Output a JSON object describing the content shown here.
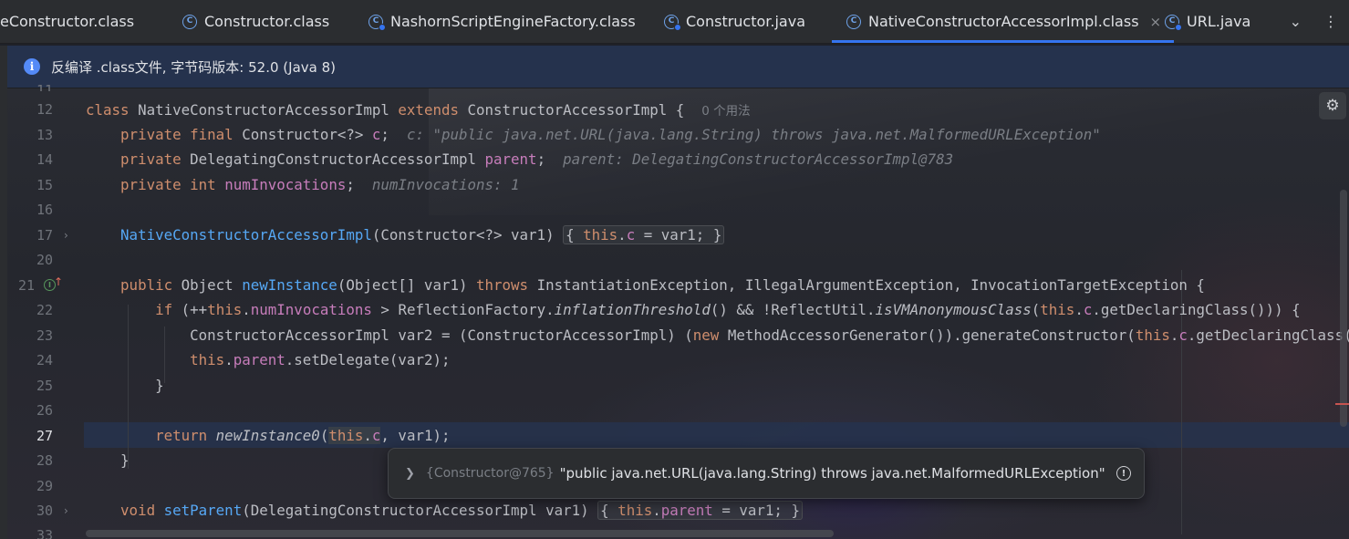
{
  "tabs": [
    {
      "label": "eConstructor.class",
      "icon": "class-icon"
    },
    {
      "label": "Constructor.class",
      "icon": "class-icon"
    },
    {
      "label": "NashornScriptEngineFactory.class",
      "icon": "class-debug-icon"
    },
    {
      "label": "Constructor.java",
      "icon": "class-debug-icon"
    },
    {
      "label": "NativeConstructorAccessorImpl.class",
      "icon": "class-icon",
      "active": true,
      "close": "×"
    },
    {
      "label": "URL.java",
      "icon": "class-debug-icon"
    }
  ],
  "tab_actions": {
    "more_tabs": "⌄",
    "menu": "⋮"
  },
  "banner": {
    "text": "反编译 .class文件, 字节码版本: 52.0 (Java 8)"
  },
  "lines": {
    "n11": "11",
    "n12": "12",
    "n13": "13",
    "n14": "14",
    "n15": "15",
    "n16": "16",
    "n17": "17",
    "n20": "20",
    "n21": "21",
    "n22": "22",
    "n23": "23",
    "n24": "24",
    "n25": "25",
    "n26": "26",
    "n27": "27",
    "n28": "28",
    "n29": "29",
    "n30": "30",
    "n33": "33"
  },
  "code": {
    "l12_class": "class ",
    "l12_name": "NativeConstructorAccessorImpl ",
    "l12_extends": "extends ",
    "l12_super": "ConstructorAccessorImpl {",
    "l12_usages": "0 个用法",
    "l13_private": "private ",
    "l13_final": "final ",
    "l13_type": "Constructor<?> ",
    "l13_field": "c",
    "l13_semi": ";",
    "l13_hint": "c: \"public java.net.URL(java.lang.String) throws java.net.MalformedURLException\"",
    "l14_private": "private ",
    "l14_type": "DelegatingConstructorAccessorImpl ",
    "l14_field": "parent",
    "l14_semi": ";",
    "l14_hint": "parent: DelegatingConstructorAccessorImpl@783",
    "l15_private": "private ",
    "l15_int": "int ",
    "l15_field": "numInvocations",
    "l15_semi": ";",
    "l15_hint": "numInvocations: 1",
    "l17_name": "NativeConstructorAccessorImpl",
    "l17_params": "(Constructor<?> var1) ",
    "l17_ob": "{",
    "l17_this": "this",
    "l17_dot": ".",
    "l17_c": "c",
    "l17_rest": " = var1; ",
    "l17_cb": "}",
    "l21_public": "public ",
    "l21_type": "Object ",
    "l21_name": "newInstance",
    "l21_params": "(Object[] var1) ",
    "l21_throws": "throws ",
    "l21_rest": "InstantiationException, IllegalArgumentException, InvocationTargetException {",
    "l22_if": "if ",
    "l22_a": "(++",
    "l22_this": "this",
    "l22_dot": ".",
    "l22_field": "numInvocations",
    "l22_b": " > ReflectionFactory.",
    "l22_m1": "inflationThreshold",
    "l22_c": "() && !ReflectUtil.",
    "l22_m2": "isVMAnonymousClass",
    "l22_d": "(",
    "l22_this2": "this",
    "l22_dot2": ".",
    "l22_c2": "c",
    "l22_e": ".getDeclaringClass())) {",
    "l23_a": "ConstructorAccessorImpl var2 = (ConstructorAccessorImpl) (",
    "l23_new": "new ",
    "l23_b": "MethodAccessorGenerator()).generateConstructor(",
    "l23_this": "this",
    "l23_dot": ".",
    "l23_c": "c",
    "l23_d": ".getDeclaringClass(),",
    "l24_this": "this",
    "l24_dot": ".",
    "l24_field": "parent",
    "l24_rest": ".setDelegate(var2);",
    "l25": "}",
    "l27_return": "return ",
    "l27_m": "newInstance0",
    "l27_a": "(",
    "l27_this": "this",
    "l27_dot": ".",
    "l27_c": "c",
    "l27_rest": ", var1);",
    "l28": "}",
    "l30_void": "void ",
    "l30_name": "setParent",
    "l30_params": "(DelegatingConstructorAccessorImpl var1) ",
    "l30_ob": "{",
    "l30_this": "this",
    "l30_dot": ".",
    "l30_field": "parent",
    "l30_rest": " = var1; ",
    "l30_cb": "}"
  },
  "tooltip": {
    "ref": "{Constructor@765}",
    "value": "\"public java.net.URL(java.lang.String) throws java.net.MalformedURLException\""
  },
  "colors": {
    "keyword": "#cf8e6d",
    "field": "#c77dbb",
    "method": "#56a8f5",
    "text": "#bcbec4",
    "accent": "#3574f0",
    "banner": "#25324d"
  }
}
